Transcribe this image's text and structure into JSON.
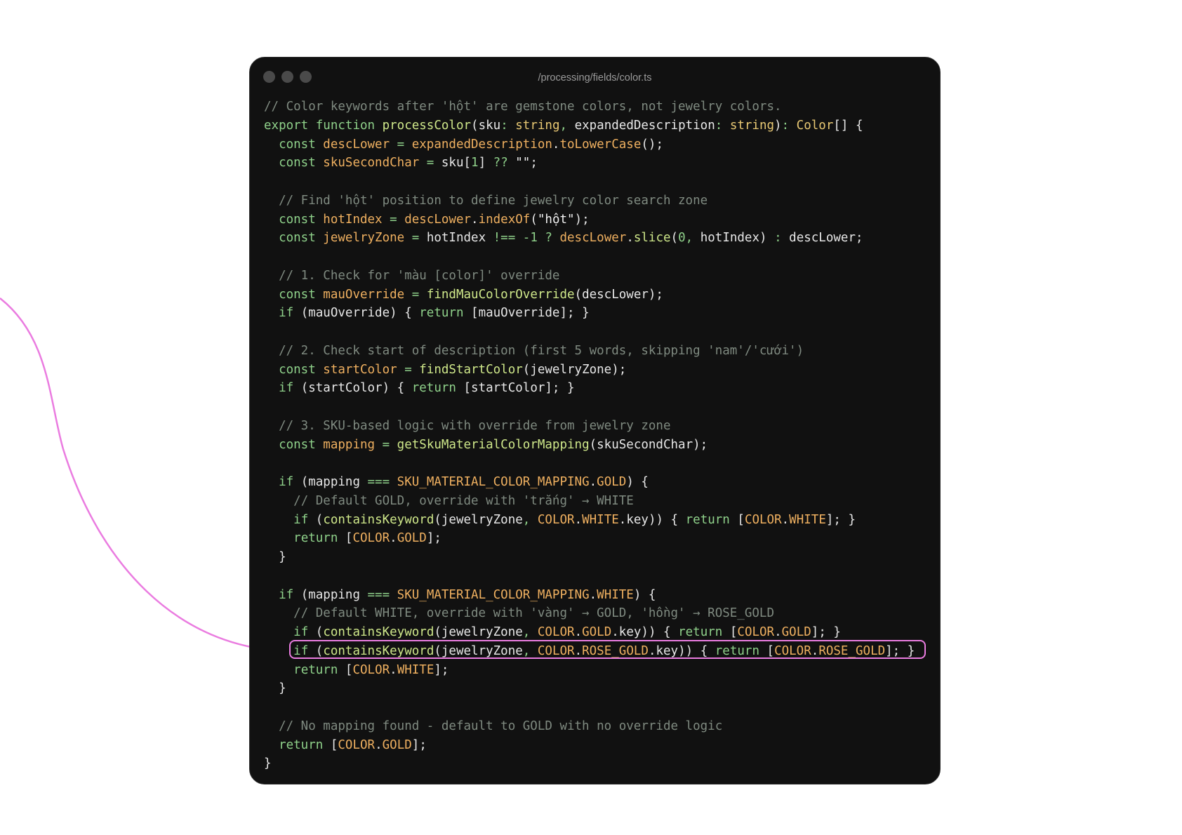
{
  "window": {
    "title": "/processing/fields/color.ts",
    "accent_color": "#ea7ce0",
    "dots": [
      "dot",
      "dot",
      "dot"
    ]
  },
  "code": {
    "highlighted_line": 30,
    "lines": [
      [
        [
          "c",
          "// Color keywords after 'hột' are gemstone colors, not jewelry colors."
        ]
      ],
      [
        [
          "k",
          "export "
        ],
        [
          "k",
          "function "
        ],
        [
          "f",
          "processColor"
        ],
        [
          "p",
          "(sku"
        ],
        [
          "k",
          ": "
        ],
        [
          "t",
          "string"
        ],
        [
          "k",
          ", "
        ],
        [
          "p",
          "expandedDescription"
        ],
        [
          "k",
          ": "
        ],
        [
          "t",
          "string"
        ],
        [
          "p",
          ")"
        ],
        [
          "k",
          ": "
        ],
        [
          "t",
          "Color"
        ],
        [
          "p",
          "[] {"
        ]
      ],
      [
        [
          "p",
          "  "
        ],
        [
          "k",
          "const "
        ],
        [
          "v",
          "descLower"
        ],
        [
          "k",
          " = "
        ],
        [
          "v",
          "expandedDescription"
        ],
        [
          "p",
          "."
        ],
        [
          "v",
          "toLowerCase"
        ],
        [
          "p",
          "();"
        ]
      ],
      [
        [
          "p",
          "  "
        ],
        [
          "k",
          "const "
        ],
        [
          "v",
          "skuSecondChar"
        ],
        [
          "k",
          " = "
        ],
        [
          "p",
          "sku["
        ],
        [
          "n",
          "1"
        ],
        [
          "p",
          "] "
        ],
        [
          "k",
          "?? "
        ],
        [
          "s",
          "\"\""
        ],
        [
          "p",
          ";"
        ]
      ],
      [],
      [
        [
          "p",
          "  "
        ],
        [
          "c",
          "// Find 'hột' position to define jewelry color search zone"
        ]
      ],
      [
        [
          "p",
          "  "
        ],
        [
          "k",
          "const "
        ],
        [
          "v",
          "hotIndex"
        ],
        [
          "k",
          " = "
        ],
        [
          "v",
          "descLower"
        ],
        [
          "p",
          "."
        ],
        [
          "v",
          "indexOf"
        ],
        [
          "p",
          "("
        ],
        [
          "s",
          "\"hột\""
        ],
        [
          "p",
          ");"
        ]
      ],
      [
        [
          "p",
          "  "
        ],
        [
          "k",
          "const "
        ],
        [
          "v",
          "jewelryZone"
        ],
        [
          "k",
          " = "
        ],
        [
          "p",
          "hotIndex "
        ],
        [
          "k",
          "!== "
        ],
        [
          "n",
          "-1"
        ],
        [
          "k",
          " ? "
        ],
        [
          "v",
          "descLower"
        ],
        [
          "p",
          "."
        ],
        [
          "f",
          "slice"
        ],
        [
          "p",
          "("
        ],
        [
          "n",
          "0"
        ],
        [
          "k",
          ", "
        ],
        [
          "p",
          "hotIndex) "
        ],
        [
          "k",
          ": "
        ],
        [
          "p",
          "descLower;"
        ]
      ],
      [],
      [
        [
          "p",
          "  "
        ],
        [
          "c",
          "// 1. Check for 'màu [color]' override"
        ]
      ],
      [
        [
          "p",
          "  "
        ],
        [
          "k",
          "const "
        ],
        [
          "v",
          "mauOverride"
        ],
        [
          "k",
          " = "
        ],
        [
          "f",
          "findMauColorOverride"
        ],
        [
          "p",
          "(descLower);"
        ]
      ],
      [
        [
          "p",
          "  "
        ],
        [
          "k",
          "if "
        ],
        [
          "p",
          "(mauOverride) { "
        ],
        [
          "k",
          "return "
        ],
        [
          "p",
          "[mauOverride]; }"
        ]
      ],
      [],
      [
        [
          "p",
          "  "
        ],
        [
          "c",
          "// 2. Check start of description (first 5 words, skipping 'nam'/'cưới')"
        ]
      ],
      [
        [
          "p",
          "  "
        ],
        [
          "k",
          "const "
        ],
        [
          "v",
          "startColor"
        ],
        [
          "k",
          " = "
        ],
        [
          "f",
          "findStartColor"
        ],
        [
          "p",
          "(jewelryZone);"
        ]
      ],
      [
        [
          "p",
          "  "
        ],
        [
          "k",
          "if "
        ],
        [
          "p",
          "(startColor) { "
        ],
        [
          "k",
          "return "
        ],
        [
          "p",
          "[startColor]; }"
        ]
      ],
      [],
      [
        [
          "p",
          "  "
        ],
        [
          "c",
          "// 3. SKU-based logic with override from jewelry zone"
        ]
      ],
      [
        [
          "p",
          "  "
        ],
        [
          "k",
          "const "
        ],
        [
          "v",
          "mapping"
        ],
        [
          "k",
          " = "
        ],
        [
          "f",
          "getSkuMaterialColorMapping"
        ],
        [
          "p",
          "(skuSecondChar);"
        ]
      ],
      [],
      [
        [
          "p",
          "  "
        ],
        [
          "k",
          "if "
        ],
        [
          "p",
          "(mapping "
        ],
        [
          "k",
          "=== "
        ],
        [
          "v",
          "SKU_MATERIAL_COLOR_MAPPING"
        ],
        [
          "p",
          "."
        ],
        [
          "v",
          "GOLD"
        ],
        [
          "p",
          ") {"
        ]
      ],
      [
        [
          "p",
          "    "
        ],
        [
          "c",
          "// Default GOLD, override with 'trắng' → WHITE"
        ]
      ],
      [
        [
          "p",
          "    "
        ],
        [
          "k",
          "if "
        ],
        [
          "p",
          "("
        ],
        [
          "f",
          "containsKeyword"
        ],
        [
          "p",
          "(jewelryZone"
        ],
        [
          "k",
          ", "
        ],
        [
          "v",
          "COLOR"
        ],
        [
          "p",
          "."
        ],
        [
          "v",
          "WHITE"
        ],
        [
          "p",
          ".key)) { "
        ],
        [
          "k",
          "return "
        ],
        [
          "p",
          "["
        ],
        [
          "v",
          "COLOR"
        ],
        [
          "p",
          "."
        ],
        [
          "v",
          "WHITE"
        ],
        [
          "p",
          "]; }"
        ]
      ],
      [
        [
          "p",
          "    "
        ],
        [
          "k",
          "return "
        ],
        [
          "p",
          "["
        ],
        [
          "v",
          "COLOR"
        ],
        [
          "p",
          "."
        ],
        [
          "v",
          "GOLD"
        ],
        [
          "p",
          "];"
        ]
      ],
      [
        [
          "p",
          "  }"
        ]
      ],
      [],
      [
        [
          "p",
          "  "
        ],
        [
          "k",
          "if "
        ],
        [
          "p",
          "(mapping "
        ],
        [
          "k",
          "=== "
        ],
        [
          "v",
          "SKU_MATERIAL_COLOR_MAPPING"
        ],
        [
          "p",
          "."
        ],
        [
          "v",
          "WHITE"
        ],
        [
          "p",
          ") {"
        ]
      ],
      [
        [
          "p",
          "    "
        ],
        [
          "c",
          "// Default WHITE, override with 'vàng' → GOLD, 'hồng' → ROSE_GOLD"
        ]
      ],
      [
        [
          "p",
          "    "
        ],
        [
          "k",
          "if "
        ],
        [
          "p",
          "("
        ],
        [
          "f",
          "containsKeyword"
        ],
        [
          "p",
          "(jewelryZone"
        ],
        [
          "k",
          ", "
        ],
        [
          "v",
          "COLOR"
        ],
        [
          "p",
          "."
        ],
        [
          "v",
          "GOLD"
        ],
        [
          "p",
          ".key)) { "
        ],
        [
          "k",
          "return "
        ],
        [
          "p",
          "["
        ],
        [
          "v",
          "COLOR"
        ],
        [
          "p",
          "."
        ],
        [
          "v",
          "GOLD"
        ],
        [
          "p",
          "]; }"
        ]
      ],
      [
        [
          "p",
          "    "
        ],
        [
          "k",
          "if "
        ],
        [
          "p",
          "("
        ],
        [
          "f",
          "containsKeyword"
        ],
        [
          "p",
          "(jewelryZone"
        ],
        [
          "k",
          ", "
        ],
        [
          "v",
          "COLOR"
        ],
        [
          "p",
          "."
        ],
        [
          "v",
          "ROSE_GOLD"
        ],
        [
          "p",
          ".key)) { "
        ],
        [
          "k",
          "return "
        ],
        [
          "p",
          "["
        ],
        [
          "v",
          "COLOR"
        ],
        [
          "p",
          "."
        ],
        [
          "v",
          "ROSE_GOLD"
        ],
        [
          "p",
          "]; }"
        ]
      ],
      [
        [
          "p",
          "    "
        ],
        [
          "k",
          "return "
        ],
        [
          "p",
          "["
        ],
        [
          "v",
          "COLOR"
        ],
        [
          "p",
          "."
        ],
        [
          "v",
          "WHITE"
        ],
        [
          "p",
          "];"
        ]
      ],
      [
        [
          "p",
          "  }"
        ]
      ],
      [],
      [
        [
          "p",
          "  "
        ],
        [
          "c",
          "// No mapping found - default to GOLD with no override logic"
        ]
      ],
      [
        [
          "p",
          "  "
        ],
        [
          "k",
          "return "
        ],
        [
          "p",
          "["
        ],
        [
          "v",
          "COLOR"
        ],
        [
          "p",
          "."
        ],
        [
          "v",
          "GOLD"
        ],
        [
          "p",
          "];"
        ]
      ],
      [
        [
          "p",
          "}"
        ]
      ]
    ]
  }
}
